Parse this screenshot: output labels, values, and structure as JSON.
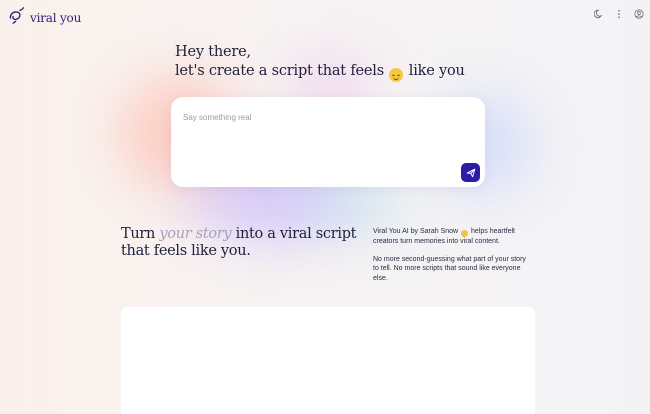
{
  "brand": {
    "name": "viral you"
  },
  "header": {
    "icons": [
      "moon-icon",
      "more-vertical-icon",
      "account-icon"
    ]
  },
  "hero": {
    "greeting": "Hey there,",
    "headline_before": "let's create a script that feels",
    "headline_emoji": "😌",
    "headline_after": "like you"
  },
  "chat": {
    "placeholder": "Say something real",
    "value": ""
  },
  "tagline": {
    "before": "Turn ",
    "accent": "your story",
    "after": " into a viral script that feels like you."
  },
  "description": {
    "line1_before": "Viral You AI by Sarah Snow",
    "line1_emoji": "👱‍♀️",
    "line1_after": "helps heartfelt creators turn memories into viral content.",
    "line2": "No more second-guessing what part of your story to tell. No more scripts that sound like everyone else."
  },
  "colors": {
    "accent": "#2b1da8",
    "text": "#1e1f3a",
    "muted_accent": "#a6a3b8"
  }
}
